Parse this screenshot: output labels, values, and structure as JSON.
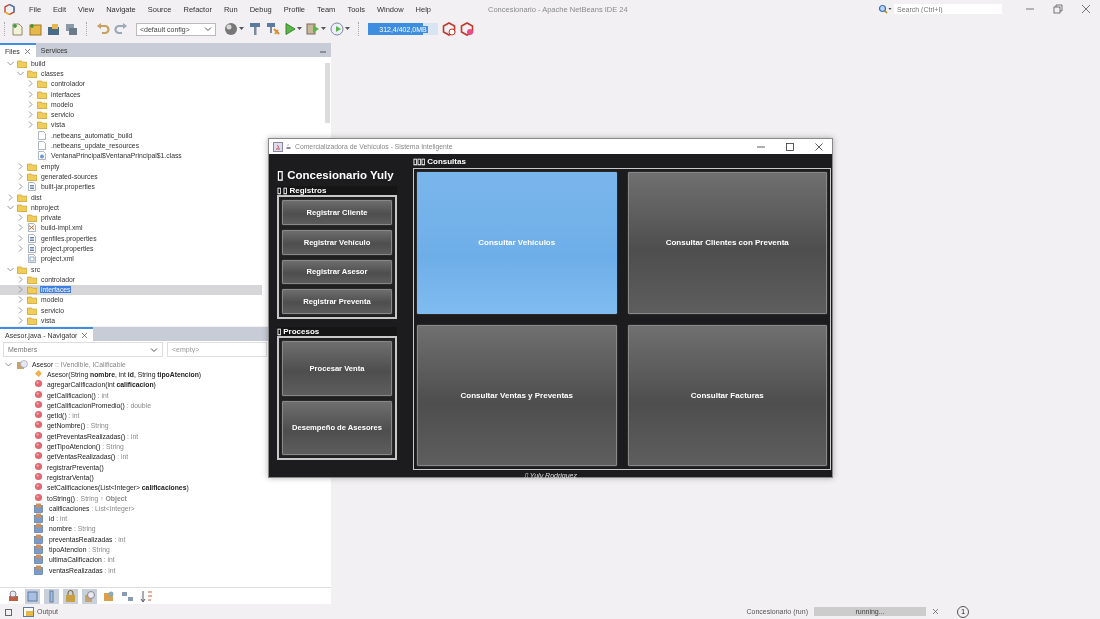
{
  "ide": {
    "title": "Concesionario - Apache NetBeans IDE 24",
    "menu": [
      "File",
      "Edit",
      "View",
      "Navigate",
      "Source",
      "Refactor",
      "Run",
      "Debug",
      "Profile",
      "Team",
      "Tools",
      "Window",
      "Help"
    ],
    "search": {
      "placeholder": "Search (Ctrl+I)"
    }
  },
  "toolbar": {
    "config": "<default config>",
    "memory": {
      "text": "312,4/402,0MB",
      "level": 0.78
    }
  },
  "files_panel": {
    "tabs": [
      {
        "label": "Files",
        "selected": true
      },
      {
        "label": "Services",
        "selected": false
      }
    ],
    "tree": [
      {
        "label": "build",
        "kind": "folder",
        "expanded": true,
        "selected": false,
        "children": [
          {
            "label": "classes",
            "kind": "folder",
            "expanded": true,
            "selected": false,
            "children": [
              {
                "label": "controlador",
                "kind": "folder",
                "expanded": false,
                "selected": false
              },
              {
                "label": "interfaces",
                "kind": "folder",
                "expanded": false,
                "selected": false
              },
              {
                "label": "modelo",
                "kind": "folder",
                "expanded": false,
                "selected": false
              },
              {
                "label": "servicio",
                "kind": "folder",
                "expanded": false,
                "selected": false
              },
              {
                "label": "vista",
                "kind": "folder",
                "expanded": false,
                "selected": false
              },
              {
                "label": ".netbeans_automatic_build",
                "kind": "file",
                "selected": false
              },
              {
                "label": ".netbeans_update_resources",
                "kind": "file",
                "selected": false
              },
              {
                "label": "VentanaPrincipal$VentanaPrincipal$1.class",
                "kind": "class",
                "selected": false
              }
            ]
          },
          {
            "label": "empty",
            "kind": "folder",
            "expanded": false,
            "selected": false
          },
          {
            "label": "generated-sources",
            "kind": "folder",
            "expanded": false,
            "selected": false
          },
          {
            "label": "built-jar.properties",
            "kind": "properties",
            "expanded": false,
            "selected": false
          }
        ]
      },
      {
        "label": "dist",
        "kind": "folder",
        "expanded": false,
        "selected": false
      },
      {
        "label": "nbproject",
        "kind": "folder",
        "expanded": true,
        "selected": false,
        "children": [
          {
            "label": "private",
            "kind": "folder",
            "expanded": false,
            "selected": false
          },
          {
            "label": "build-impl.xml",
            "kind": "ant",
            "expanded": false,
            "selected": false
          },
          {
            "label": "genfiles.properties",
            "kind": "properties",
            "expanded": false,
            "selected": false
          },
          {
            "label": "project.properties",
            "kind": "properties",
            "expanded": false,
            "selected": false
          },
          {
            "label": "project.xml",
            "kind": "xml",
            "selected": false
          }
        ]
      },
      {
        "label": "src",
        "kind": "folder",
        "expanded": true,
        "selected": false,
        "children": [
          {
            "label": "controlador",
            "kind": "folder",
            "expanded": false,
            "selected": false
          },
          {
            "label": "interfaces",
            "kind": "folder",
            "expanded": false,
            "selected": true
          },
          {
            "label": "modelo",
            "kind": "folder",
            "expanded": false,
            "selected": false
          },
          {
            "label": "servicio",
            "kind": "folder",
            "expanded": false,
            "selected": false
          },
          {
            "label": "vista",
            "kind": "folder",
            "expanded": false,
            "selected": false
          }
        ]
      }
    ]
  },
  "navigator": {
    "tab": "Asesor.java - Navigator",
    "filter": "Members",
    "second_filter": {
      "placeholder": "<empty>"
    },
    "tree": [
      {
        "label": "Asesor",
        "type": ":: IVendible, ICalificable",
        "kind": "class",
        "expanded": true,
        "children": [
          {
            "label": "Asesor(String **nombre**, int **id**, String **tipoAtencion**)",
            "kind": "constructor"
          },
          {
            "label": "agregarCalificacion(int **calificacion**)",
            "kind": "method"
          },
          {
            "label": "getCalificacion()",
            "type": ": int",
            "kind": "method"
          },
          {
            "label": "getCalificacionPromedio()",
            "type": ": double",
            "kind": "method"
          },
          {
            "label": "getId()",
            "type": ": int",
            "kind": "method"
          },
          {
            "label": "getNombre()",
            "type": ": String",
            "kind": "method"
          },
          {
            "label": "getPreventasRealizadas()",
            "type": ": int",
            "kind": "method"
          },
          {
            "label": "getTipoAtencion()",
            "type": ": String",
            "kind": "method"
          },
          {
            "label": "getVentasRealizadas()",
            "type": ": int",
            "kind": "method"
          },
          {
            "label": "registrarPreventa()",
            "kind": "method"
          },
          {
            "label": "registrarVenta()",
            "kind": "method"
          },
          {
            "label": "setCalificaciones(List<Integer> **calificaciones**)",
            "kind": "method"
          },
          {
            "label": "toString()",
            "type": ": String ↑ **Object**",
            "kind": "method"
          },
          {
            "label": "calificaciones",
            "type": ": List<Integer>",
            "kind": "field"
          },
          {
            "label": "id",
            "type": ": int",
            "kind": "field"
          },
          {
            "label": "nombre",
            "type": ": String",
            "kind": "field"
          },
          {
            "label": "preventasRealizadas",
            "type": ": int",
            "kind": "field"
          },
          {
            "label": "tipoAtencion",
            "type": ": String",
            "kind": "field"
          },
          {
            "label": "ultimaCalificacion",
            "type": ": int",
            "kind": "field"
          },
          {
            "label": "ventasRealizadas",
            "type": ": int",
            "kind": "field"
          }
        ]
      }
    ]
  },
  "status_bar": {
    "output_tab": "Output",
    "task": "Concesionario (run)",
    "progress": "running...",
    "notifications": "1"
  },
  "app_window": {
    "title": "Comercializadora de Vehículos - Sistema Inteligente",
    "heading": "▯ Concesionario Yuly",
    "groups": [
      {
        "label": "▯ ▯ Registros",
        "buttons": [
          "Registrar Cliente",
          "Registrar Vehículo",
          "Registrar Asesor",
          "Registrar Preventa"
        ]
      },
      {
        "label": "▯ Procesos",
        "buttons": [
          "Procesar Venta",
          "Desempeño de Asesores"
        ]
      }
    ],
    "consultas": {
      "label": "▯▯▯ Consultas",
      "buttons": [
        {
          "label": "Consultar Vehículos",
          "highlighted": true
        },
        {
          "label": "Consultar Clientes con Preventa",
          "highlighted": false
        },
        {
          "label": "Consultar Ventas y Preventas",
          "highlighted": false
        },
        {
          "label": "Consultar Facturas",
          "highlighted": false
        }
      ]
    },
    "footer": "▯ Yuly Rodriguez"
  }
}
